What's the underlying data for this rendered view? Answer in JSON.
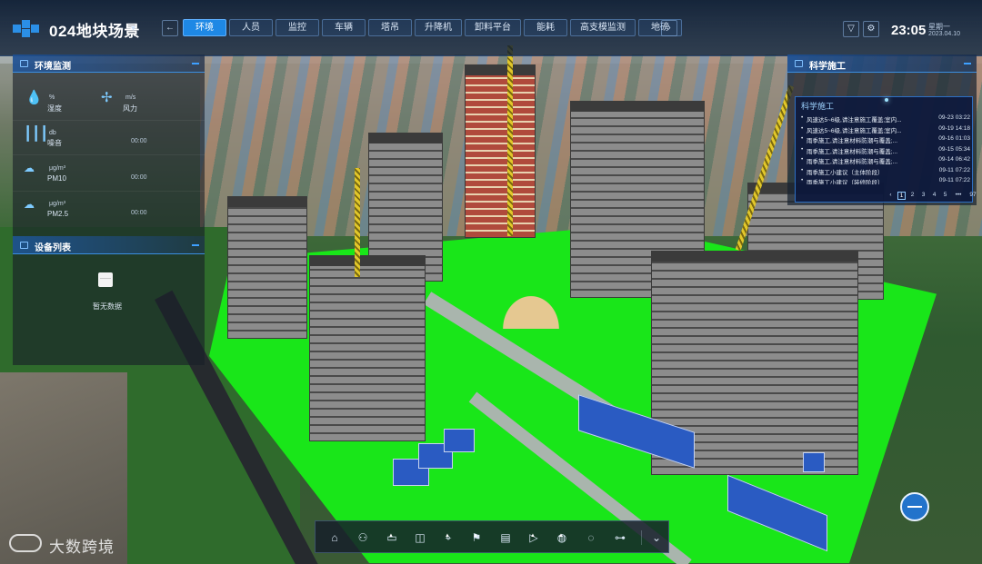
{
  "header": {
    "project_title": "024地块场景",
    "tabs": [
      {
        "label": "环境",
        "active": true
      },
      {
        "label": "人员",
        "active": false
      },
      {
        "label": "监控",
        "active": false
      },
      {
        "label": "车辆",
        "active": false
      },
      {
        "label": "塔吊",
        "active": false
      },
      {
        "label": "升降机",
        "active": false
      },
      {
        "label": "卸料平台",
        "active": false
      },
      {
        "label": "能耗",
        "active": false
      },
      {
        "label": "高支模监测",
        "active": false
      },
      {
        "label": "地磅",
        "active": false
      }
    ],
    "time": "23:05",
    "weekday": "星期一",
    "date": "2023.04.10",
    "icons": [
      "filter-icon",
      "gear-icon"
    ]
  },
  "env_panel": {
    "title": "环境监测",
    "metrics": [
      {
        "name": "湿度",
        "unit": "%",
        "time": "",
        "icon": "humidity-icon"
      },
      {
        "name": "风力",
        "unit": "m/s",
        "time": "",
        "icon": "fan-icon"
      },
      {
        "name": "噪音",
        "unit": "db",
        "time": "00:00",
        "icon": "noise-icon"
      },
      {
        "name": "PM10",
        "unit": "μg/m³",
        "time": "00:00",
        "icon": "pm-icon"
      },
      {
        "name": "PM2.5",
        "unit": "μg/m³",
        "time": "00:00",
        "icon": "pm-icon"
      }
    ]
  },
  "device_panel": {
    "title": "设备列表",
    "empty_text": "暂无数据"
  },
  "science_panel": {
    "title": "科学施工",
    "inner_title": "科学施工",
    "items": [
      {
        "text": "风速达5~6级,请注意施工覆盖;室内...",
        "time": "09-23 03:22"
      },
      {
        "text": "风速达5~6级,请注意施工覆盖;室内...",
        "time": "09-19 14:18"
      },
      {
        "text": "雨季施工,请注意材料防潮与覆盖;...",
        "time": "09-16 01:03"
      },
      {
        "text": "雨季施工,请注意材料防潮与覆盖;...",
        "time": "09-15 05:34"
      },
      {
        "text": "雨季施工,请注意材料防潮与覆盖;...",
        "time": "09-14 06:42"
      },
      {
        "text": "雨季施工小建议（主体阶段）",
        "time": "09-11 07:22"
      },
      {
        "text": "雨季施工小建议（装修阶段）",
        "time": "09-11 07:22"
      }
    ],
    "pager": [
      "1",
      "2",
      "3",
      "4",
      "5",
      "•••",
      "97"
    ],
    "pager_prev": "‹",
    "pager_next": "›"
  },
  "toolbar": {
    "tools": [
      "home-icon",
      "network-icon",
      "layers-icon",
      "split-icon",
      "location-icon",
      "flag-icon",
      "chart-icon",
      "play-icon",
      "globe-icon",
      "measure-icon",
      "settings-sliders-icon"
    ],
    "collapse": "⌄"
  },
  "watermark": "大数跨境"
}
